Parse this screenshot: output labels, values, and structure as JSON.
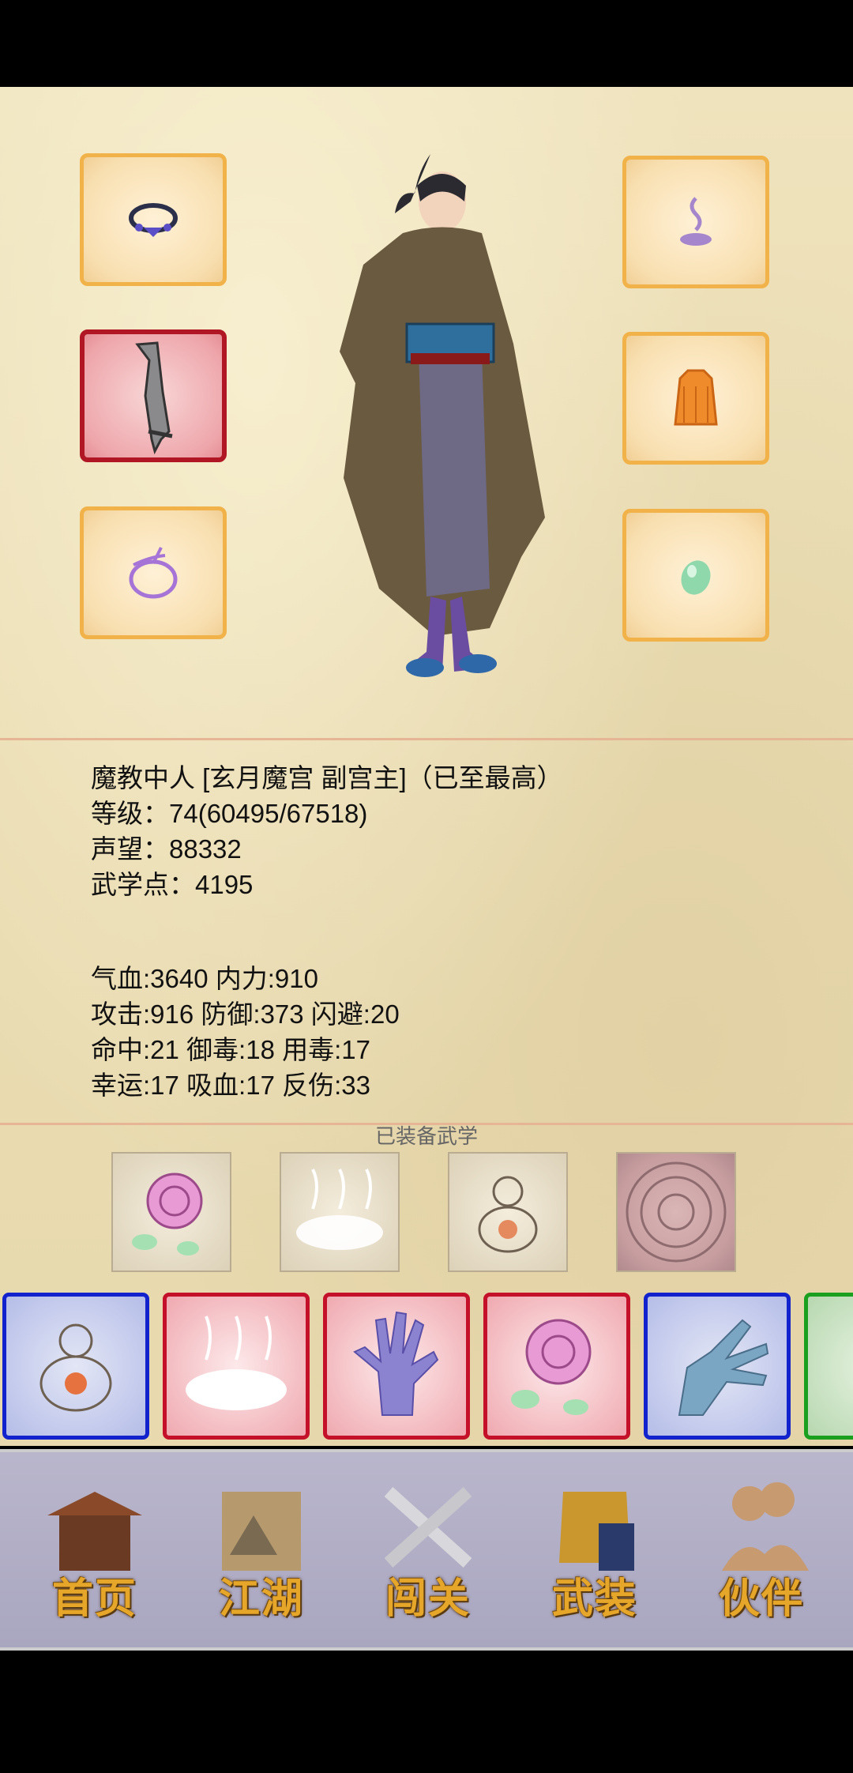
{
  "character": {
    "title_line": "魔教中人 [玄月魔宫 副宫主]（已至最高）",
    "level_line": "等级：74(60495/67518)",
    "reputation_line": "声望：88332",
    "martial_points_line": "武学点：4195"
  },
  "stats": {
    "line1": "气血:3640  内力:910",
    "line2": "攻击:916  防御:373  闪避:20",
    "line3": "命中:21  御毒:18  用毒:17",
    "line4": "幸运:17  吸血:17  反伤:33"
  },
  "equipped_skills_title": "已装备武学",
  "nav": {
    "home": "首页",
    "jianghu": "江湖",
    "challenge": "闯关",
    "equipment": "武装",
    "partner": "伙伴"
  },
  "colors": {
    "slot_border": "#f2b24a",
    "selected_border": "#b01624",
    "card_blue": "#1222cc",
    "card_red": "#c41028",
    "card_green": "#1aa01e",
    "nav_label": "#e6a62a"
  }
}
